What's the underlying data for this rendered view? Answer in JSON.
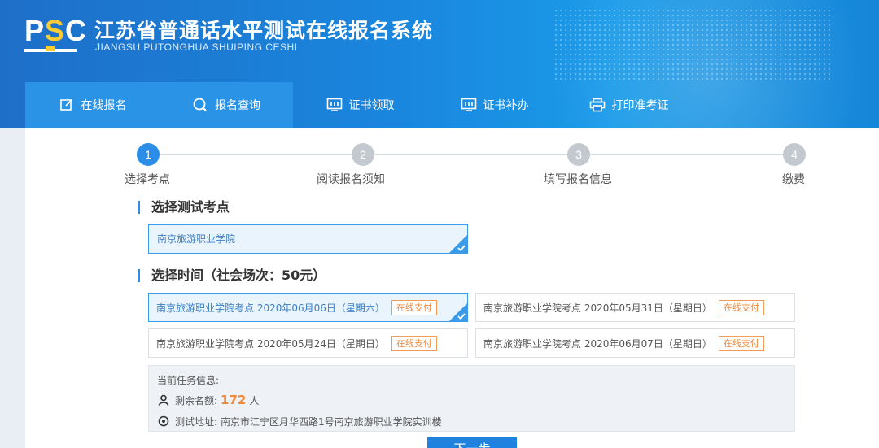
{
  "header": {
    "logo": "PSC",
    "title_cn": "江苏省普通话水平测试在线报名系统",
    "title_en": "JIANGSU PUTONGHUA SHUIPING CESHI"
  },
  "nav": {
    "items": [
      {
        "label": "在线报名",
        "icon": "edit-icon"
      },
      {
        "label": "报名查询",
        "icon": "search-icon"
      },
      {
        "label": "证书领取",
        "icon": "certificate-icon"
      },
      {
        "label": "证书补办",
        "icon": "certificate-icon"
      },
      {
        "label": "打印准考证",
        "icon": "printer-icon"
      }
    ],
    "active_index": 0
  },
  "steps": [
    {
      "num": "1",
      "label": "选择考点"
    },
    {
      "num": "2",
      "label": "阅读报名须知"
    },
    {
      "num": "3",
      "label": "填写报名信息"
    },
    {
      "num": "4",
      "label": "缴费"
    }
  ],
  "section_site": {
    "title": "选择测试考点",
    "selected_site": "南京旅游职业学院"
  },
  "section_time": {
    "title": "选择时间（社会场次：50元）",
    "slots": [
      {
        "text": "南京旅游职业学院考点 2020年06月06日（星期六）",
        "badge": "在线支付",
        "selected": true
      },
      {
        "text": "南京旅游职业学院考点 2020年05月31日（星期日）",
        "badge": "在线支付",
        "selected": false
      },
      {
        "text": "南京旅游职业学院考点 2020年05月24日（星期日）",
        "badge": "在线支付",
        "selected": false
      },
      {
        "text": "南京旅游职业学院考点 2020年06月07日（星期日）",
        "badge": "在线支付",
        "selected": false
      }
    ]
  },
  "task_info": {
    "heading": "当前任务信息:",
    "remaining_label": "剩余名额:",
    "remaining_count": "172",
    "remaining_unit": "人",
    "address_label": "测试地址:",
    "address": "南京市江宁区月华西路1号南京旅游职业学院实训楼"
  },
  "next_button": "下一步",
  "colors": {
    "primary": "#2a8ee8",
    "accent_orange": "#f0883a",
    "header_blue": "#1a86de"
  }
}
